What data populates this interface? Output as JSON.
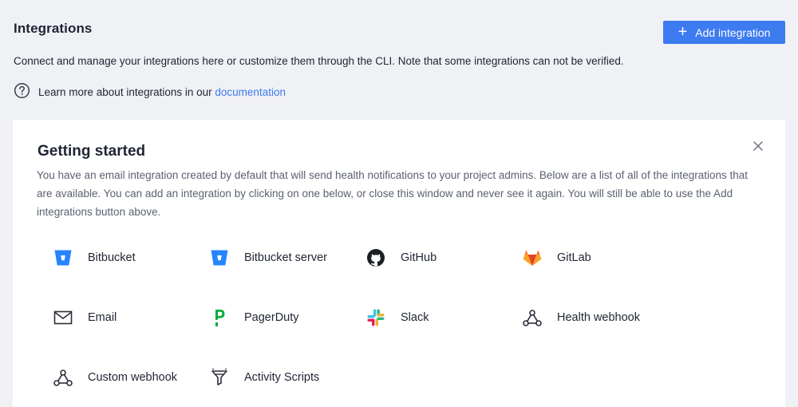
{
  "header": {
    "title": "Integrations",
    "add_button_label": "Add integration",
    "description": "Connect and manage your integrations here or customize them through the CLI. Note that some integrations can not be verified.",
    "learn_prefix": "Learn more about integrations in our",
    "learn_link": "documentation"
  },
  "getting_started": {
    "title": "Getting started",
    "description": "You have an email integration created by default that will send health notifications to your project admins. Below are a list of all of the integrations that are available. You can add an integration by clicking on one below, or close this window and never see it again. You will still be able to use the Add integrations button above.",
    "integrations": [
      {
        "label": "Bitbucket",
        "icon": "bitbucket-icon"
      },
      {
        "label": "Bitbucket server",
        "icon": "bitbucket-server-icon"
      },
      {
        "label": "GitHub",
        "icon": "github-icon"
      },
      {
        "label": "GitLab",
        "icon": "gitlab-icon"
      },
      {
        "label": "Email",
        "icon": "email-icon"
      },
      {
        "label": "PagerDuty",
        "icon": "pagerduty-icon"
      },
      {
        "label": "Slack",
        "icon": "slack-icon"
      },
      {
        "label": "Health webhook",
        "icon": "webhook-icon"
      },
      {
        "label": "Custom webhook",
        "icon": "webhook-icon"
      },
      {
        "label": "Activity Scripts",
        "icon": "activity-scripts-icon"
      }
    ]
  },
  "colors": {
    "accent": "#3d7bf0",
    "background": "#f0f1f5",
    "bitbucket": "#2684ff",
    "gitlab": "#fc6d26",
    "pagerduty": "#06ac38"
  }
}
